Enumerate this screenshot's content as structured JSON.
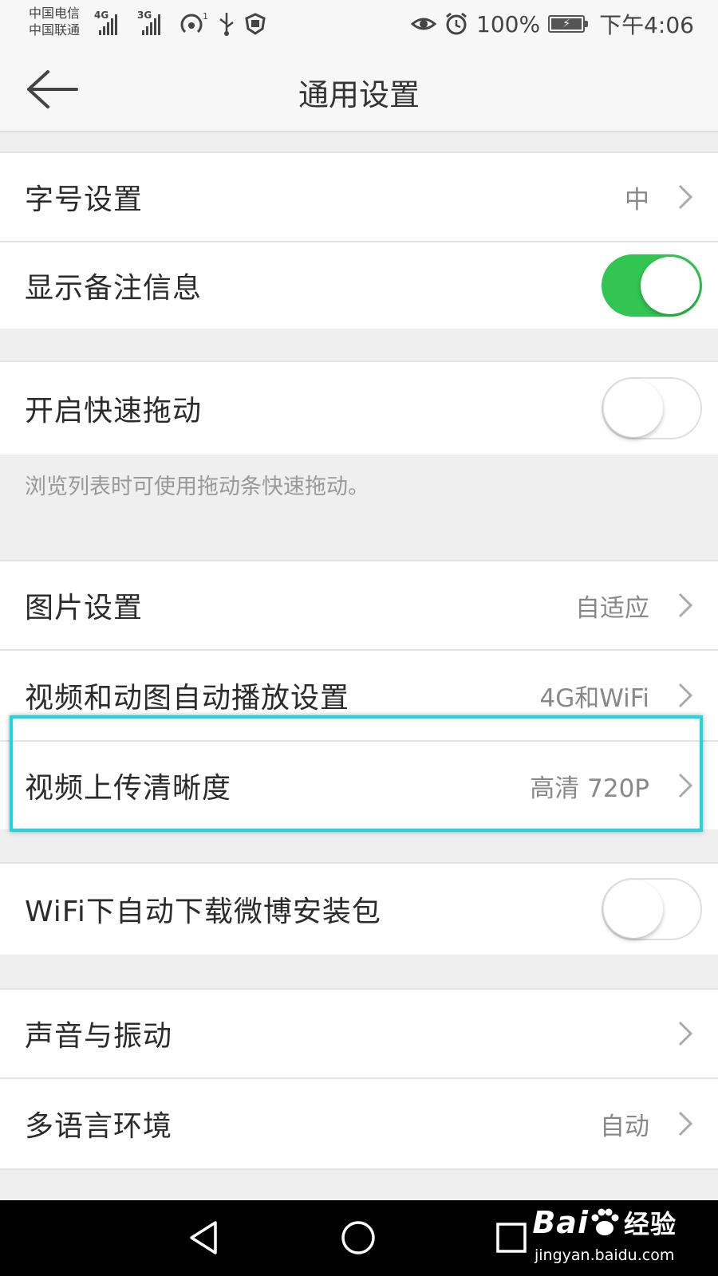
{
  "status_bar": {
    "carrier_1": "中国电信",
    "carrier_2": "中国联通",
    "network_1": "4G",
    "network_2": "3G",
    "hotspot_count": "1",
    "battery": "100%",
    "time": "下午4:06",
    "icons": [
      "signal-icon",
      "hotspot-icon",
      "usb-icon",
      "shield-icon",
      "eye-icon",
      "alarm-icon",
      "battery-icon"
    ]
  },
  "header": {
    "title": "通用设置",
    "back_icon": "arrow-left-icon"
  },
  "settings": {
    "font_size": {
      "label": "字号设置",
      "value": "中"
    },
    "show_remark": {
      "label": "显示备注信息",
      "enabled": true
    },
    "fast_drag": {
      "label": "开启快速拖动",
      "enabled": false,
      "hint": "浏览列表时可使用拖动条快速拖动。"
    },
    "image": {
      "label": "图片设置",
      "value": "自适应"
    },
    "autoplay": {
      "label": "视频和动图自动播放设置",
      "value": "4G和WiFi"
    },
    "upload_quality": {
      "label": "视频上传清晰度",
      "value": "高清 720P"
    },
    "wifi_download": {
      "label": "WiFi下自动下载微博安装包",
      "enabled": false
    },
    "sound": {
      "label": "声音与振动"
    },
    "language": {
      "label": "多语言环境",
      "value": "自动"
    }
  },
  "colors": {
    "toggle_on": "#32c551",
    "highlight_border": "#19d9de"
  },
  "watermark": {
    "brand": "Bai",
    "brand_cn": "经验",
    "url": "jingyan.baidu.com"
  }
}
